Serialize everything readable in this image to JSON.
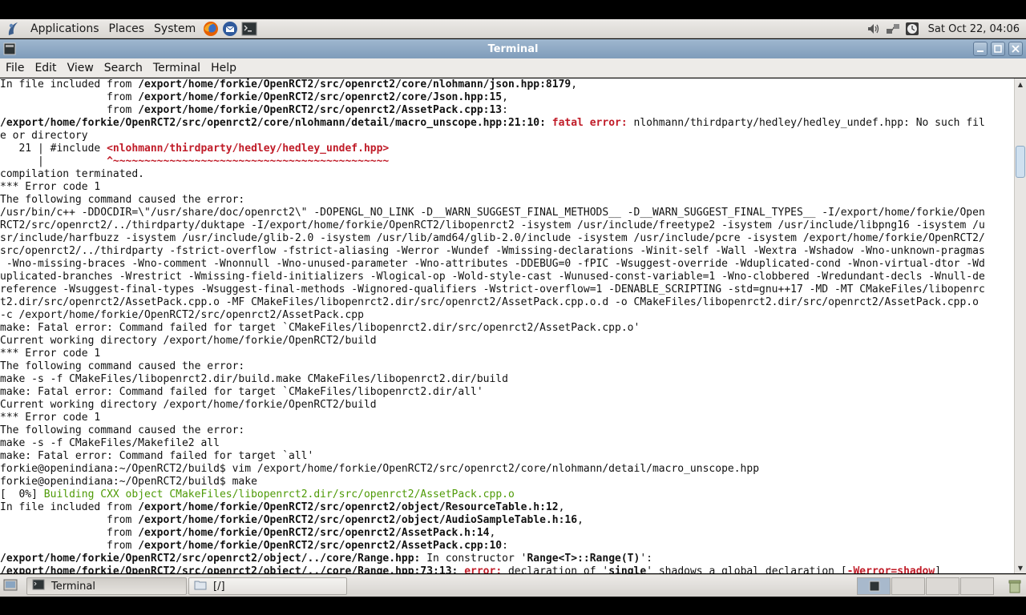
{
  "top_panel": {
    "menus": [
      "Applications",
      "Places",
      "System"
    ],
    "clock": "Sat Oct 22, 04:06"
  },
  "window": {
    "title": "Terminal"
  },
  "menubar": [
    "File",
    "Edit",
    "View",
    "Search",
    "Terminal",
    "Help"
  ],
  "terminal": {
    "lines": [
      [
        {
          "t": "In file included from "
        },
        {
          "t": "/export/home/forkie/OpenRCT2/src/openrct2/core/nlohmann/json.hpp:8179",
          "c": "b"
        },
        {
          "t": ","
        }
      ],
      [
        {
          "t": "                 from "
        },
        {
          "t": "/export/home/forkie/OpenRCT2/src/openrct2/core/Json.hpp:15",
          "c": "b"
        },
        {
          "t": ","
        }
      ],
      [
        {
          "t": "                 from "
        },
        {
          "t": "/export/home/forkie/OpenRCT2/src/openrct2/AssetPack.cpp:13",
          "c": "b"
        },
        {
          "t": ":"
        }
      ],
      [
        {
          "t": "/export/home/forkie/OpenRCT2/src/openrct2/core/nlohmann/detail/macro_unscope.hpp:21:10: ",
          "c": "b"
        },
        {
          "t": "fatal error: ",
          "c": "red"
        },
        {
          "t": "nlohmann/thirdparty/hedley/hedley_undef.hpp: No such fil"
        }
      ],
      [
        {
          "t": "e or directory"
        }
      ],
      [
        {
          "t": "   21 | #include "
        },
        {
          "t": "<nlohmann/thirdparty/hedley/hedley_undef.hpp>",
          "c": "red"
        }
      ],
      [
        {
          "t": "      |          "
        },
        {
          "t": "^~~~~~~~~~~~~~~~~~~~~~~~~~~~~~~~~~~~~~~~~~~~~",
          "c": "red"
        }
      ],
      [
        {
          "t": "compilation terminated."
        }
      ],
      [
        {
          "t": "*** Error code 1"
        }
      ],
      [
        {
          "t": "The following command caused the error:"
        }
      ],
      [
        {
          "t": "/usr/bin/c++ -DDOCDIR=\\\"/usr/share/doc/openrct2\\\" -DOPENGL_NO_LINK -D__WARN_SUGGEST_FINAL_METHODS__ -D__WARN_SUGGEST_FINAL_TYPES__ -I/export/home/forkie/Open"
        }
      ],
      [
        {
          "t": "RCT2/src/openrct2/../thirdparty/duktape -I/export/home/forkie/OpenRCT2/libopenrct2 -isystem /usr/include/freetype2 -isystem /usr/include/libpng16 -isystem /u"
        }
      ],
      [
        {
          "t": "sr/include/harfbuzz -isystem /usr/include/glib-2.0 -isystem /usr/lib/amd64/glib-2.0/include -isystem /usr/include/pcre -isystem /export/home/forkie/OpenRCT2/"
        }
      ],
      [
        {
          "t": "src/openrct2/../thirdparty -fstrict-overflow -fstrict-aliasing -Werror -Wundef -Wmissing-declarations -Winit-self -Wall -Wextra -Wshadow -Wno-unknown-pragmas"
        }
      ],
      [
        {
          "t": " -Wno-missing-braces -Wno-comment -Wnonnull -Wno-unused-parameter -Wno-attributes -DDEBUG=0 -fPIC -Wsuggest-override -Wduplicated-cond -Wnon-virtual-dtor -Wd"
        }
      ],
      [
        {
          "t": "uplicated-branches -Wrestrict -Wmissing-field-initializers -Wlogical-op -Wold-style-cast -Wunused-const-variable=1 -Wno-clobbered -Wredundant-decls -Wnull-de"
        }
      ],
      [
        {
          "t": "reference -Wsuggest-final-types -Wsuggest-final-methods -Wignored-qualifiers -Wstrict-overflow=1 -DENABLE_SCRIPTING -std=gnu++17 -MD -MT CMakeFiles/libopenrc"
        }
      ],
      [
        {
          "t": "t2.dir/src/openrct2/AssetPack.cpp.o -MF CMakeFiles/libopenrct2.dir/src/openrct2/AssetPack.cpp.o.d -o CMakeFiles/libopenrct2.dir/src/openrct2/AssetPack.cpp.o"
        }
      ],
      [
        {
          "t": "-c /export/home/forkie/OpenRCT2/src/openrct2/AssetPack.cpp"
        }
      ],
      [
        {
          "t": "make: Fatal error: Command failed for target `CMakeFiles/libopenrct2.dir/src/openrct2/AssetPack.cpp.o'"
        }
      ],
      [
        {
          "t": "Current working directory /export/home/forkie/OpenRCT2/build"
        }
      ],
      [
        {
          "t": "*** Error code 1"
        }
      ],
      [
        {
          "t": "The following command caused the error:"
        }
      ],
      [
        {
          "t": "make -s -f CMakeFiles/libopenrct2.dir/build.make CMakeFiles/libopenrct2.dir/build"
        }
      ],
      [
        {
          "t": "make: Fatal error: Command failed for target `CMakeFiles/libopenrct2.dir/all'"
        }
      ],
      [
        {
          "t": "Current working directory /export/home/forkie/OpenRCT2/build"
        }
      ],
      [
        {
          "t": "*** Error code 1"
        }
      ],
      [
        {
          "t": "The following command caused the error:"
        }
      ],
      [
        {
          "t": "make -s -f CMakeFiles/Makefile2 all"
        }
      ],
      [
        {
          "t": "make: Fatal error: Command failed for target `all'"
        }
      ],
      [
        {
          "t": "forkie@openindiana:~/OpenRCT2/build$ vim /export/home/forkie/OpenRCT2/src/openrct2/core/nlohmann/detail/macro_unscope.hpp"
        }
      ],
      [
        {
          "t": "forkie@openindiana:~/OpenRCT2/build$ make"
        }
      ],
      [
        {
          "t": "[  0%] "
        },
        {
          "t": "Building CXX object CMakeFiles/libopenrct2.dir/src/openrct2/AssetPack.cpp.o",
          "c": "green"
        }
      ],
      [
        {
          "t": "In file included from "
        },
        {
          "t": "/export/home/forkie/OpenRCT2/src/openrct2/object/ResourceTable.h:12",
          "c": "b"
        },
        {
          "t": ","
        }
      ],
      [
        {
          "t": "                 from "
        },
        {
          "t": "/export/home/forkie/OpenRCT2/src/openrct2/object/AudioSampleTable.h:16",
          "c": "b"
        },
        {
          "t": ","
        }
      ],
      [
        {
          "t": "                 from "
        },
        {
          "t": "/export/home/forkie/OpenRCT2/src/openrct2/AssetPack.h:14",
          "c": "b"
        },
        {
          "t": ","
        }
      ],
      [
        {
          "t": "                 from "
        },
        {
          "t": "/export/home/forkie/OpenRCT2/src/openrct2/AssetPack.cpp:10",
          "c": "b"
        },
        {
          "t": ":"
        }
      ],
      [
        {
          "t": "/export/home/forkie/OpenRCT2/src/openrct2/object/../core/Range.hpp:",
          "c": "b"
        },
        {
          "t": " In constructor '"
        },
        {
          "t": "Range<T>::Range(T)",
          "c": "b"
        },
        {
          "t": "':"
        }
      ],
      [
        {
          "t": "/export/home/forkie/OpenRCT2/src/openrct2/object/../core/Range.hpp:73:13: ",
          "c": "b"
        },
        {
          "t": "error: ",
          "c": "red"
        },
        {
          "t": "declaration of '"
        },
        {
          "t": "single",
          "c": "b"
        },
        {
          "t": "' shadows a global declaration ["
        },
        {
          "t": "-Werror=shadow",
          "c": "red"
        },
        {
          "t": "]"
        }
      ]
    ]
  },
  "taskbar": {
    "tasks": [
      {
        "label": "Terminal"
      },
      {
        "label": "[/]"
      }
    ]
  }
}
